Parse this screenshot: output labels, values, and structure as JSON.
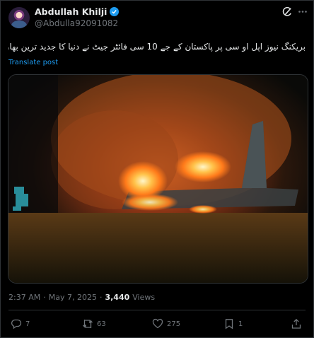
{
  "author": {
    "display_name": "Abdullah Khilji",
    "handle": "@Abdulla92091082",
    "avatar_icon": "avatar-image",
    "verified_color": "#1d9bf0"
  },
  "header_actions": [
    "grok-icon",
    "more-icon"
  ],
  "post": {
    "text": "بریکنگ نیوز اپل او سی پر پاکستان کے جے 10 سی فائٹر جیٹ نے دنیا کا جدید ترین بھارت کا رافیل طیارہ مار گرایا۔",
    "translate_label": "Translate post"
  },
  "media": {
    "type": "photo",
    "description_icon": "burning-jet-image"
  },
  "meta": {
    "time": "2:37 AM",
    "separator": "·",
    "date": "May 7, 2025",
    "views_count": "3,440",
    "views_label": "Views"
  },
  "actions": {
    "replies": "7",
    "reposts": "63",
    "likes": "275",
    "bookmarks": "1"
  },
  "colors": {
    "background": "#000000",
    "text": "#e7e9ea",
    "muted": "#71767b",
    "accent": "#1d9bf0",
    "border": "#2f3336"
  }
}
